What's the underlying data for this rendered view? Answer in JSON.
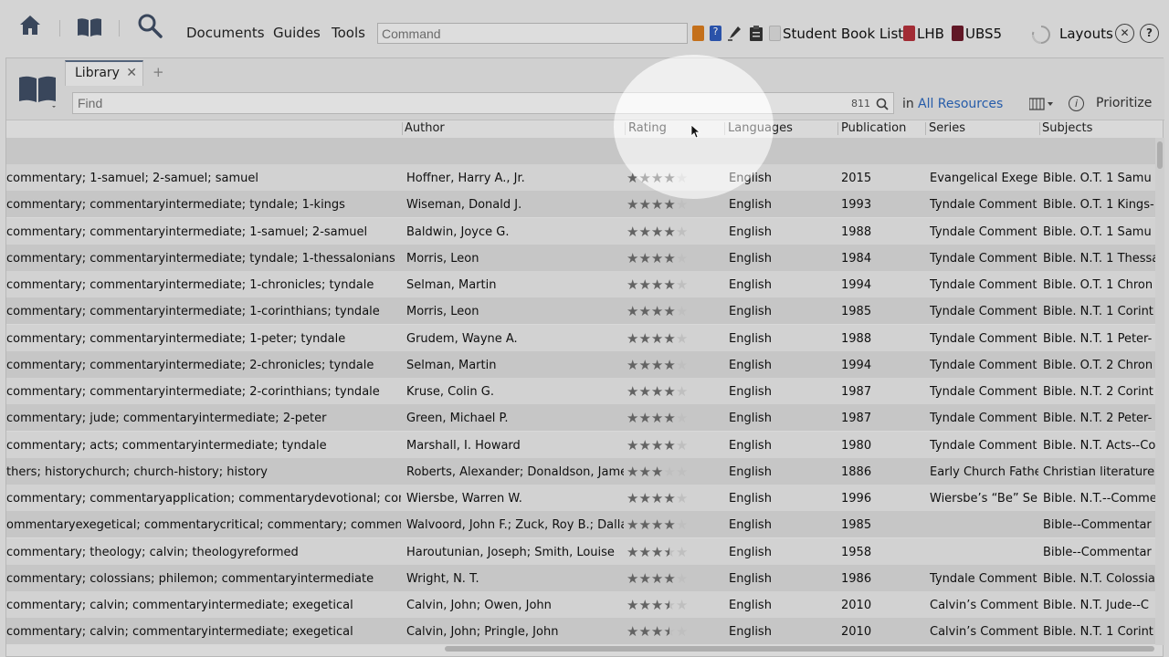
{
  "toolbar": {
    "menus": [
      "Documents",
      "Guides",
      "Tools"
    ],
    "command_placeholder": "Command",
    "quick_links": [
      "Student Book List",
      "LHB",
      "UBS5"
    ],
    "layouts_label": "Layouts",
    "icons": [
      "home-icon",
      "library-icon",
      "search-icon",
      "sync-icon",
      "close-icon",
      "help-icon"
    ]
  },
  "panel": {
    "tab_label": "Library",
    "add_tab": "+",
    "find_placeholder": "Find",
    "result_count": "811",
    "in_label": "in",
    "scope": "All Resources",
    "prioritize": "Prioritize"
  },
  "columns": {
    "author": "Author",
    "rating": "Rating",
    "languages": "Languages",
    "publication": "Publication",
    "series": "Series",
    "subjects": "Subjects"
  },
  "rows": [
    {
      "tags": "commentary; 1-samuel; 2-samuel; samuel",
      "author": "Hoffner, Harry A., Jr.",
      "rating": 4,
      "language": "English",
      "year": "2015",
      "series": "Evangelical Exeget",
      "subjects": "Bible. O.T. 1 Samu"
    },
    {
      "tags": "commentary; commentaryintermediate; tyndale; 1-kings",
      "author": "Wiseman, Donald J.",
      "rating": 4,
      "language": "English",
      "year": "1993",
      "series": "Tyndale Comment",
      "subjects": "Bible. O.T. 1 Kings-"
    },
    {
      "tags": "commentary; commentaryintermediate; 1-samuel; 2-samuel",
      "author": "Baldwin, Joyce G.",
      "rating": 4,
      "language": "English",
      "year": "1988",
      "series": "Tyndale Comment",
      "subjects": "Bible. O.T. 1 Samu"
    },
    {
      "tags": "commentary; commentaryintermediate; tyndale; 1-thessalonians",
      "author": "Morris, Leon",
      "rating": 4,
      "language": "English",
      "year": "1984",
      "series": "Tyndale Comment",
      "subjects": "Bible. N.T. 1 Thessa"
    },
    {
      "tags": "commentary; commentaryintermediate; 1-chronicles; tyndale",
      "author": "Selman, Martin",
      "rating": 4,
      "language": "English",
      "year": "1994",
      "series": "Tyndale Comment",
      "subjects": "Bible. O.T. 1 Chron"
    },
    {
      "tags": "commentary; commentaryintermediate; 1-corinthians; tyndale",
      "author": "Morris, Leon",
      "rating": 4,
      "language": "English",
      "year": "1985",
      "series": "Tyndale Comment",
      "subjects": "Bible. N.T. 1 Corint"
    },
    {
      "tags": "commentary; commentaryintermediate; 1-peter; tyndale",
      "author": "Grudem, Wayne A.",
      "rating": 4,
      "language": "English",
      "year": "1988",
      "series": "Tyndale Comment",
      "subjects": "Bible. N.T. 1 Peter-"
    },
    {
      "tags": "commentary; commentaryintermediate; 2-chronicles; tyndale",
      "author": "Selman, Martin",
      "rating": 4,
      "language": "English",
      "year": "1994",
      "series": "Tyndale Comment",
      "subjects": "Bible. O.T. 2 Chron"
    },
    {
      "tags": "commentary; commentaryintermediate; 2-corinthians; tyndale",
      "author": "Kruse, Colin G.",
      "rating": 4,
      "language": "English",
      "year": "1987",
      "series": "Tyndale Comment",
      "subjects": "Bible. N.T. 2 Corint"
    },
    {
      "tags": "commentary; jude; commentaryintermediate; 2-peter",
      "author": "Green, Michael P.",
      "rating": 4,
      "language": "English",
      "year": "1987",
      "series": "Tyndale Comment",
      "subjects": "Bible. N.T. 2 Peter-"
    },
    {
      "tags": "commentary; acts; commentaryintermediate; tyndale",
      "author": "Marshall, I. Howard",
      "rating": 4,
      "language": "English",
      "year": "1980",
      "series": "Tyndale Comment",
      "subjects": "Bible. N.T. Acts--Co"
    },
    {
      "tags": "thers; historychurch; church-history; history",
      "author": "Roberts, Alexander; Donaldson, James",
      "rating": 3,
      "language": "English",
      "year": "1886",
      "series": "Early Church Fathe",
      "subjects": "Christian literature"
    },
    {
      "tags": "commentary; commentaryapplication; commentarydevotional; commentary",
      "author": "Wiersbe, Warren W.",
      "rating": 4,
      "language": "English",
      "year": "1996",
      "series": "Wiersbe’s “Be” Ser",
      "subjects": "Bible. N.T.--Comme"
    },
    {
      "tags": "ommentaryexegetical; commentarycritical; commentary; commentary",
      "author": "Walvoord, John F.; Zuck, Roy B.; Dallas",
      "rating": 4,
      "language": "English",
      "year": "1985",
      "series": "",
      "subjects": "Bible--Commentar"
    },
    {
      "tags": "commentary; theology; calvin; theologyreformed",
      "author": "Haroutunian, Joseph; Smith, Louise",
      "rating": 3.5,
      "language": "English",
      "year": "1958",
      "series": "",
      "subjects": "Bible--Commentar"
    },
    {
      "tags": "commentary; colossians; philemon; commentaryintermediate",
      "author": "Wright, N. T.",
      "rating": 4,
      "language": "English",
      "year": "1986",
      "series": "Tyndale Comment",
      "subjects": "Bible. N.T. Colossia"
    },
    {
      "tags": "commentary; calvin; commentaryintermediate; exegetical",
      "author": "Calvin, John; Owen, John",
      "rating": 3.5,
      "language": "English",
      "year": "2010",
      "series": "Calvin’s Comment",
      "subjects": "Bible. N.T. Jude--C"
    },
    {
      "tags": "commentary; calvin; commentaryintermediate; exegetical",
      "author": "Calvin, John; Pringle, John",
      "rating": 3.5,
      "language": "English",
      "year": "2010",
      "series": "Calvin’s Comment",
      "subjects": "Bible. N.T. 1 Corint"
    }
  ],
  "colors": {
    "accent": "#2a64b8",
    "star_on": "#6c6c6c",
    "star_off": "#d0d0d0",
    "lhb": "#b0303a",
    "ubs5": "#6a1a2a"
  }
}
